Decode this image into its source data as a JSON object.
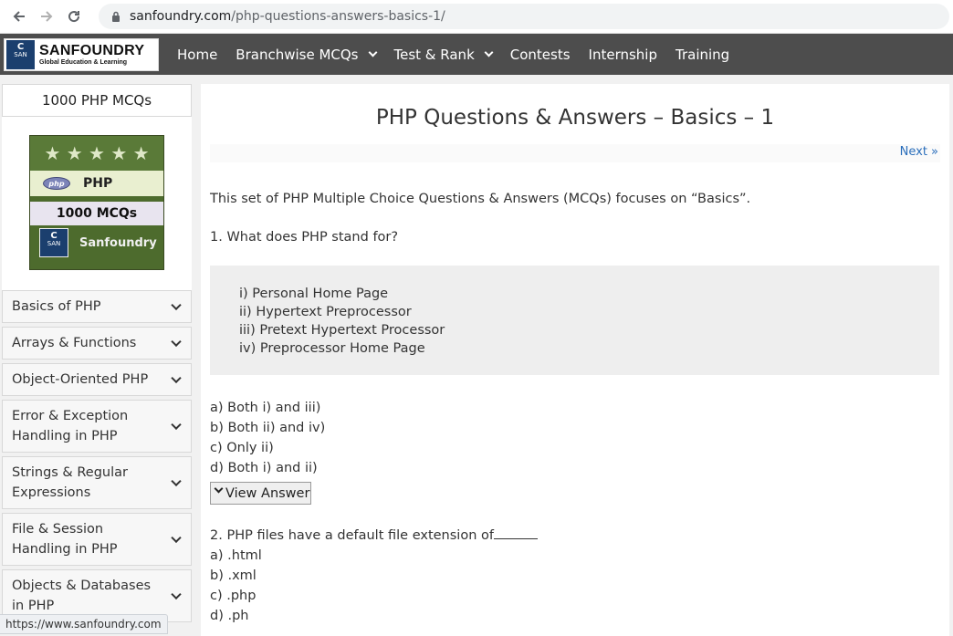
{
  "browser": {
    "url_host": "sanfoundry.com",
    "url_path": "/php-questions-answers-basics-1/"
  },
  "header": {
    "logo_title": "SANFOUNDRY",
    "logo_subtitle": "Global Education & Learning",
    "logo_badge_top": "C",
    "logo_badge_mid": "SAN",
    "menu": [
      {
        "label": "Home",
        "dropdown": false
      },
      {
        "label": "Branchwise MCQs",
        "dropdown": true
      },
      {
        "label": "Test & Rank",
        "dropdown": true
      },
      {
        "label": "Contests",
        "dropdown": false
      },
      {
        "label": "Internship",
        "dropdown": false
      },
      {
        "label": "Training",
        "dropdown": false
      }
    ]
  },
  "sidebar": {
    "title": "1000 PHP MCQs",
    "cover": {
      "stars": "★ ★ ★ ★ ★",
      "lang_badge": "php",
      "lang": "PHP",
      "mcq_label": "1000 MCQs",
      "brand": "Sanfoundry",
      "logo_top": "C",
      "logo_mid": "SAN"
    },
    "items": [
      {
        "label": "Basics of PHP"
      },
      {
        "label": "Arrays & Functions"
      },
      {
        "label": "Object-Oriented PHP"
      },
      {
        "label": "Error & Exception Handling in PHP"
      },
      {
        "label": "Strings & Regular Expressions"
      },
      {
        "label": "File & Session Handling in PHP"
      },
      {
        "label": "Objects & Databases in PHP"
      }
    ]
  },
  "main": {
    "title": "PHP Questions & Answers – Basics – 1",
    "next_link": "Next »",
    "intro": "This set of PHP Multiple Choice Questions & Answers (MCQs) focuses on “Basics”.",
    "q1": {
      "question": "1. What does PHP stand for?",
      "choices": [
        "i) Personal Home Page",
        "ii) Hypertext Preprocessor",
        "iii) Pretext Hypertext Processor",
        "iv) Preprocessor Home Page"
      ],
      "options": [
        "a) Both i) and iii)",
        "b) Both ii) and iv)",
        "c) Only ii)",
        "d) Both i) and ii)"
      ],
      "view_answer": "View Answer"
    },
    "q2": {
      "question": "2. PHP files have a default file extension of",
      "options": [
        "a) .html",
        "b) .xml",
        "c) .php",
        "d) .ph"
      ]
    }
  },
  "status_bar": {
    "text": "https://www.sanfoundry.com"
  }
}
